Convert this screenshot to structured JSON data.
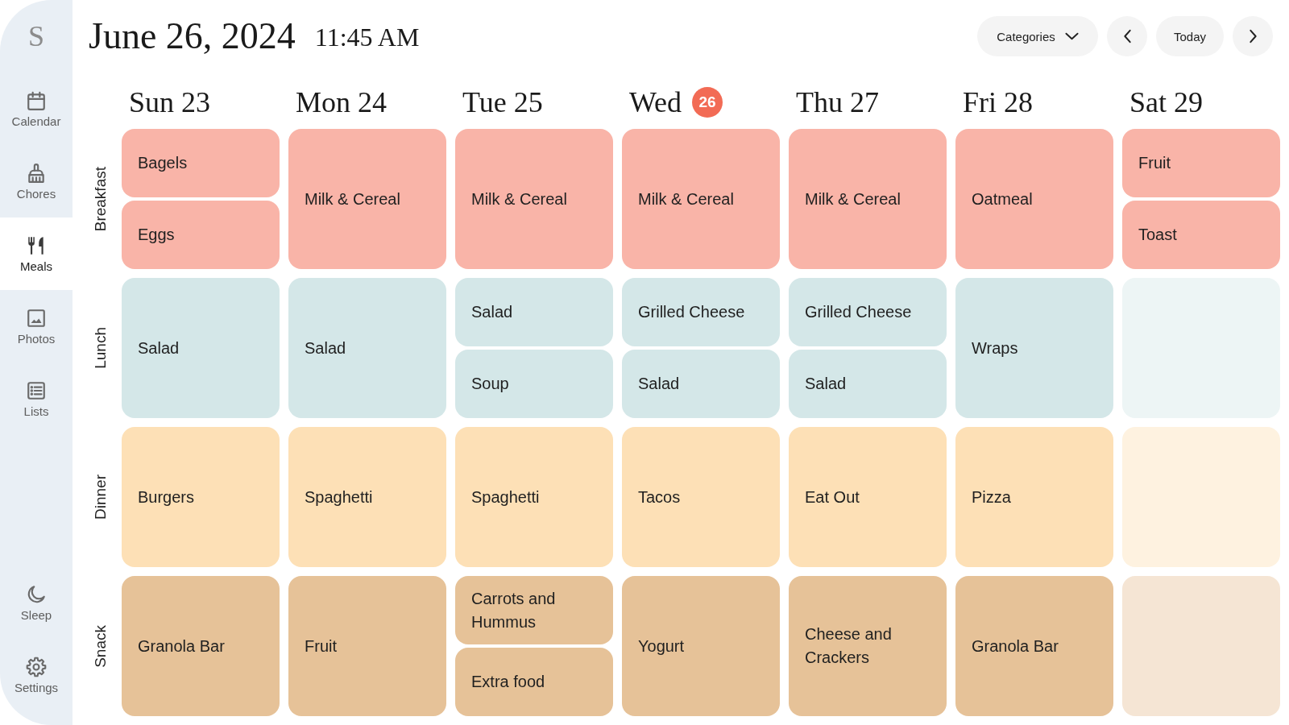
{
  "sidebar": {
    "logo": "S",
    "items": [
      {
        "label": "Calendar",
        "selected": false
      },
      {
        "label": "Chores",
        "selected": false
      },
      {
        "label": "Meals",
        "selected": true
      },
      {
        "label": "Photos",
        "selected": false
      },
      {
        "label": "Lists",
        "selected": false
      }
    ],
    "bottom_items": [
      {
        "label": "Sleep",
        "selected": false
      },
      {
        "label": "Settings",
        "selected": false
      }
    ]
  },
  "header": {
    "date": "June 26, 2024",
    "time": "11:45 AM",
    "categories_button": "Categories",
    "today_button": "Today"
  },
  "days": [
    {
      "weekday": "Sun",
      "date": "23",
      "today": false
    },
    {
      "weekday": "Mon",
      "date": "24",
      "today": false
    },
    {
      "weekday": "Tue",
      "date": "25",
      "today": false
    },
    {
      "weekday": "Wed",
      "date": "26",
      "today": true
    },
    {
      "weekday": "Thu",
      "date": "27",
      "today": false
    },
    {
      "weekday": "Fri",
      "date": "28",
      "today": false
    },
    {
      "weekday": "Sat",
      "date": "29",
      "today": false
    }
  ],
  "meal_rows": [
    {
      "label": "Breakfast",
      "color": "#f9b4a8",
      "cells": [
        {
          "kind": "meal",
          "items": [
            "Bagels",
            "Eggs"
          ]
        },
        {
          "kind": "meal",
          "items": [
            "Milk & Cereal"
          ]
        },
        {
          "kind": "meal",
          "items": [
            "Milk & Cereal"
          ]
        },
        {
          "kind": "meal",
          "items": [
            "Milk & Cereal"
          ]
        },
        {
          "kind": "meal",
          "items": [
            "Milk & Cereal"
          ]
        },
        {
          "kind": "meal",
          "items": [
            "Oatmeal"
          ]
        },
        {
          "kind": "meal",
          "items": [
            "Fruit",
            "Toast"
          ]
        }
      ]
    },
    {
      "label": "Lunch",
      "color": "#d4e7e8",
      "cells": [
        {
          "kind": "meal",
          "items": [
            "Salad"
          ]
        },
        {
          "kind": "meal",
          "items": [
            "Salad"
          ]
        },
        {
          "kind": "meal",
          "items": [
            "Salad",
            "Soup"
          ]
        },
        {
          "kind": "meal",
          "items": [
            "Grilled Cheese",
            "Salad"
          ]
        },
        {
          "kind": "meal",
          "items": [
            "Grilled Cheese",
            "Salad"
          ]
        },
        {
          "kind": "meal",
          "items": [
            "Wraps"
          ]
        },
        {
          "kind": "empty"
        }
      ]
    },
    {
      "label": "Dinner",
      "color": "#fde0b6",
      "cells": [
        {
          "kind": "meal",
          "items": [
            "Burgers"
          ]
        },
        {
          "kind": "meal",
          "items": [
            "Spaghetti"
          ]
        },
        {
          "kind": "meal",
          "items": [
            "Spaghetti"
          ]
        },
        {
          "kind": "meal",
          "items": [
            "Tacos"
          ]
        },
        {
          "kind": "meal",
          "items": [
            "Eat Out"
          ]
        },
        {
          "kind": "meal",
          "items": [
            "Pizza"
          ]
        },
        {
          "kind": "empty"
        }
      ]
    },
    {
      "label": "Snack",
      "color": "#e6c298",
      "cells": [
        {
          "kind": "meal",
          "items": [
            "Granola Bar"
          ]
        },
        {
          "kind": "meal",
          "items": [
            "Fruit"
          ]
        },
        {
          "kind": "meal",
          "items": [
            "Carrots and Hummus",
            "Extra food"
          ]
        },
        {
          "kind": "meal",
          "items": [
            "Yogurt"
          ]
        },
        {
          "kind": "meal",
          "items": [
            "Cheese and Crackers"
          ]
        },
        {
          "kind": "meal",
          "items": [
            "Granola Bar"
          ]
        },
        {
          "kind": "empty"
        }
      ]
    }
  ]
}
